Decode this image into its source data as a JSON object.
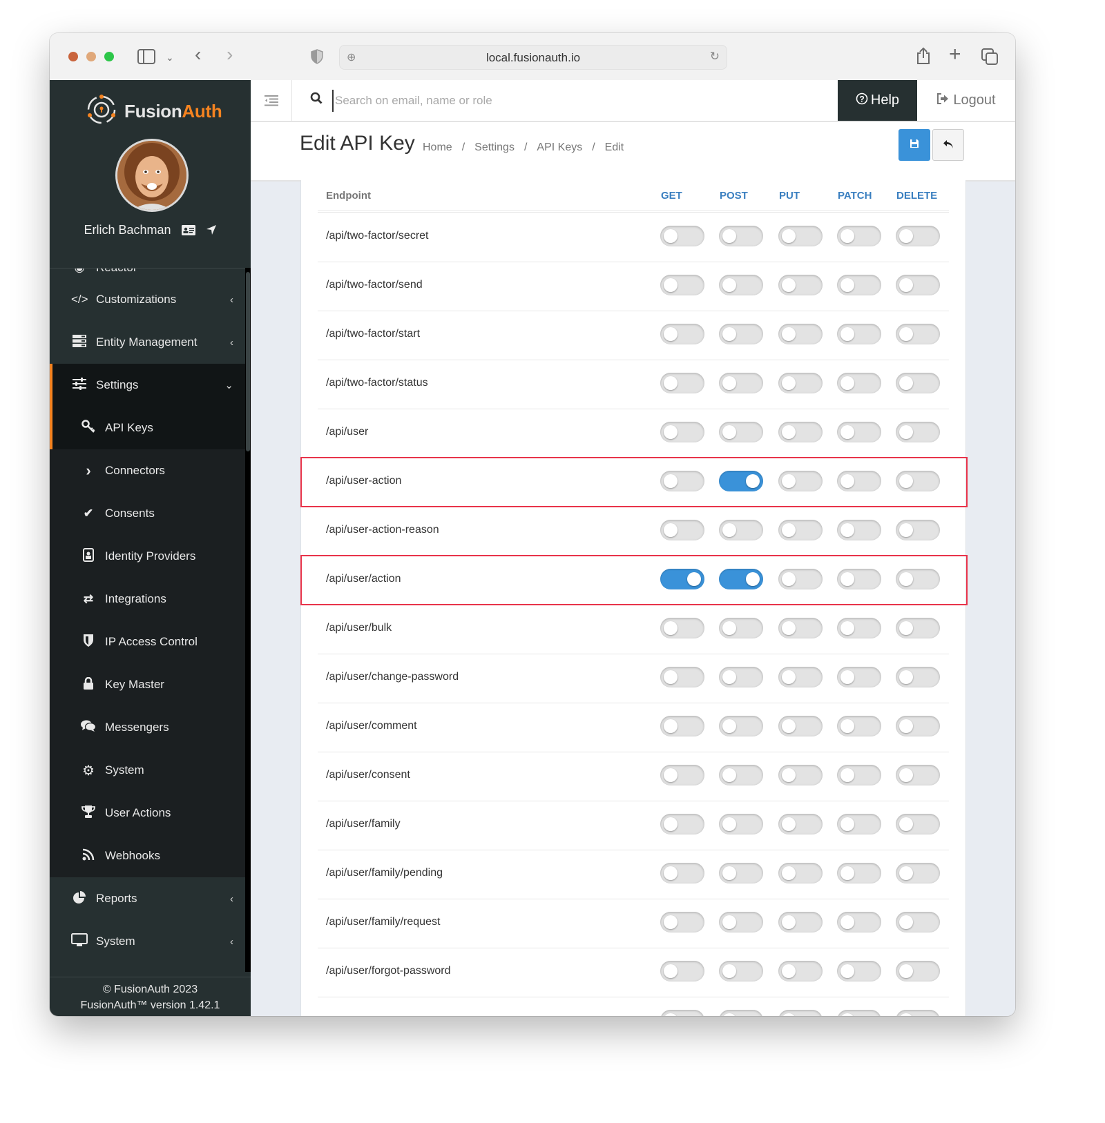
{
  "browser": {
    "url": "local.fusionauth.io",
    "icons": [
      "sidebar-toggle-icon",
      "chevron-down-icon",
      "back-icon",
      "forward-icon",
      "shield-icon",
      "globe-icon",
      "reload-icon",
      "share-icon",
      "new-tab-icon",
      "tabs-overview-icon"
    ]
  },
  "brand": {
    "name_part1": "Fusion",
    "name_part2": "Auth",
    "accent_color": "#f58320"
  },
  "user": {
    "name": "Erlich Bachman"
  },
  "sidebar": {
    "partial_item": "Reactor",
    "items": [
      {
        "label": "Customizations",
        "icon": "code-icon",
        "chevron": "‹"
      },
      {
        "label": "Entity Management",
        "icon": "server-icon",
        "chevron": "‹"
      },
      {
        "label": "Settings",
        "icon": "sliders-icon",
        "chevron": "⌄"
      }
    ],
    "settings_sub": [
      {
        "label": "API Keys",
        "icon": "key-icon"
      },
      {
        "label": "Connectors",
        "icon": "chevron-right-icon"
      },
      {
        "label": "Consents",
        "icon": "check-icon"
      },
      {
        "label": "Identity Providers",
        "icon": "id-badge-icon"
      },
      {
        "label": "Integrations",
        "icon": "exchange-icon"
      },
      {
        "label": "IP Access Control",
        "icon": "shield-icon"
      },
      {
        "label": "Key Master",
        "icon": "lock-icon"
      },
      {
        "label": "Messengers",
        "icon": "comments-icon"
      },
      {
        "label": "System",
        "icon": "gear-icon"
      },
      {
        "label": "User Actions",
        "icon": "trophy-icon"
      },
      {
        "label": "Webhooks",
        "icon": "rss-icon"
      }
    ],
    "bottom_items": [
      {
        "label": "Reports",
        "icon": "pie-chart-icon",
        "chevron": "‹"
      },
      {
        "label": "System",
        "icon": "desktop-icon",
        "chevron": "‹"
      }
    ],
    "footer": {
      "copyright": "© FusionAuth 2023",
      "version": "FusionAuth™ version 1.42.1"
    }
  },
  "topbar": {
    "search_placeholder": "Search on email, name or role",
    "search_value": "",
    "help_label": "Help",
    "logout_label": "Logout"
  },
  "page": {
    "title": "Edit API Key",
    "breadcrumb": [
      "Home",
      "Settings",
      "API Keys",
      "Edit"
    ],
    "breadcrumb_separator": "/"
  },
  "table": {
    "columns": [
      "Endpoint",
      "GET",
      "POST",
      "PUT",
      "PATCH",
      "DELETE"
    ],
    "rows": [
      {
        "endpoint": "/api/two-factor/secret",
        "GET": false,
        "POST": false,
        "PUT": false,
        "PATCH": false,
        "DELETE": false
      },
      {
        "endpoint": "/api/two-factor/send",
        "GET": false,
        "POST": false,
        "PUT": false,
        "PATCH": false,
        "DELETE": false
      },
      {
        "endpoint": "/api/two-factor/start",
        "GET": false,
        "POST": false,
        "PUT": false,
        "PATCH": false,
        "DELETE": false
      },
      {
        "endpoint": "/api/two-factor/status",
        "GET": false,
        "POST": false,
        "PUT": false,
        "PATCH": false,
        "DELETE": false
      },
      {
        "endpoint": "/api/user",
        "GET": false,
        "POST": false,
        "PUT": false,
        "PATCH": false,
        "DELETE": false
      },
      {
        "endpoint": "/api/user-action",
        "GET": false,
        "POST": true,
        "PUT": false,
        "PATCH": false,
        "DELETE": false,
        "highlighted": true
      },
      {
        "endpoint": "/api/user-action-reason",
        "GET": false,
        "POST": false,
        "PUT": false,
        "PATCH": false,
        "DELETE": false
      },
      {
        "endpoint": "/api/user/action",
        "GET": true,
        "POST": true,
        "PUT": false,
        "PATCH": false,
        "DELETE": false,
        "highlighted": true
      },
      {
        "endpoint": "/api/user/bulk",
        "GET": false,
        "POST": false,
        "PUT": false,
        "PATCH": false,
        "DELETE": false
      },
      {
        "endpoint": "/api/user/change-password",
        "GET": false,
        "POST": false,
        "PUT": false,
        "PATCH": false,
        "DELETE": false
      },
      {
        "endpoint": "/api/user/comment",
        "GET": false,
        "POST": false,
        "PUT": false,
        "PATCH": false,
        "DELETE": false
      },
      {
        "endpoint": "/api/user/consent",
        "GET": false,
        "POST": false,
        "PUT": false,
        "PATCH": false,
        "DELETE": false
      },
      {
        "endpoint": "/api/user/family",
        "GET": false,
        "POST": false,
        "PUT": false,
        "PATCH": false,
        "DELETE": false
      },
      {
        "endpoint": "/api/user/family/pending",
        "GET": false,
        "POST": false,
        "PUT": false,
        "PATCH": false,
        "DELETE": false
      },
      {
        "endpoint": "/api/user/family/request",
        "GET": false,
        "POST": false,
        "PUT": false,
        "PATCH": false,
        "DELETE": false
      },
      {
        "endpoint": "/api/user/forgot-password",
        "GET": false,
        "POST": false,
        "PUT": false,
        "PATCH": false,
        "DELETE": false
      },
      {
        "endpoint": "",
        "GET": false,
        "POST": false,
        "PUT": false,
        "PATCH": false,
        "DELETE": false,
        "partial": true
      }
    ]
  },
  "colors": {
    "toggle_on": "#3a92d9",
    "toggle_off": "#e3e3e3",
    "highlight_border": "#e8334a",
    "method_header": "#3a7fc0",
    "sidebar_bg": "#263031"
  }
}
